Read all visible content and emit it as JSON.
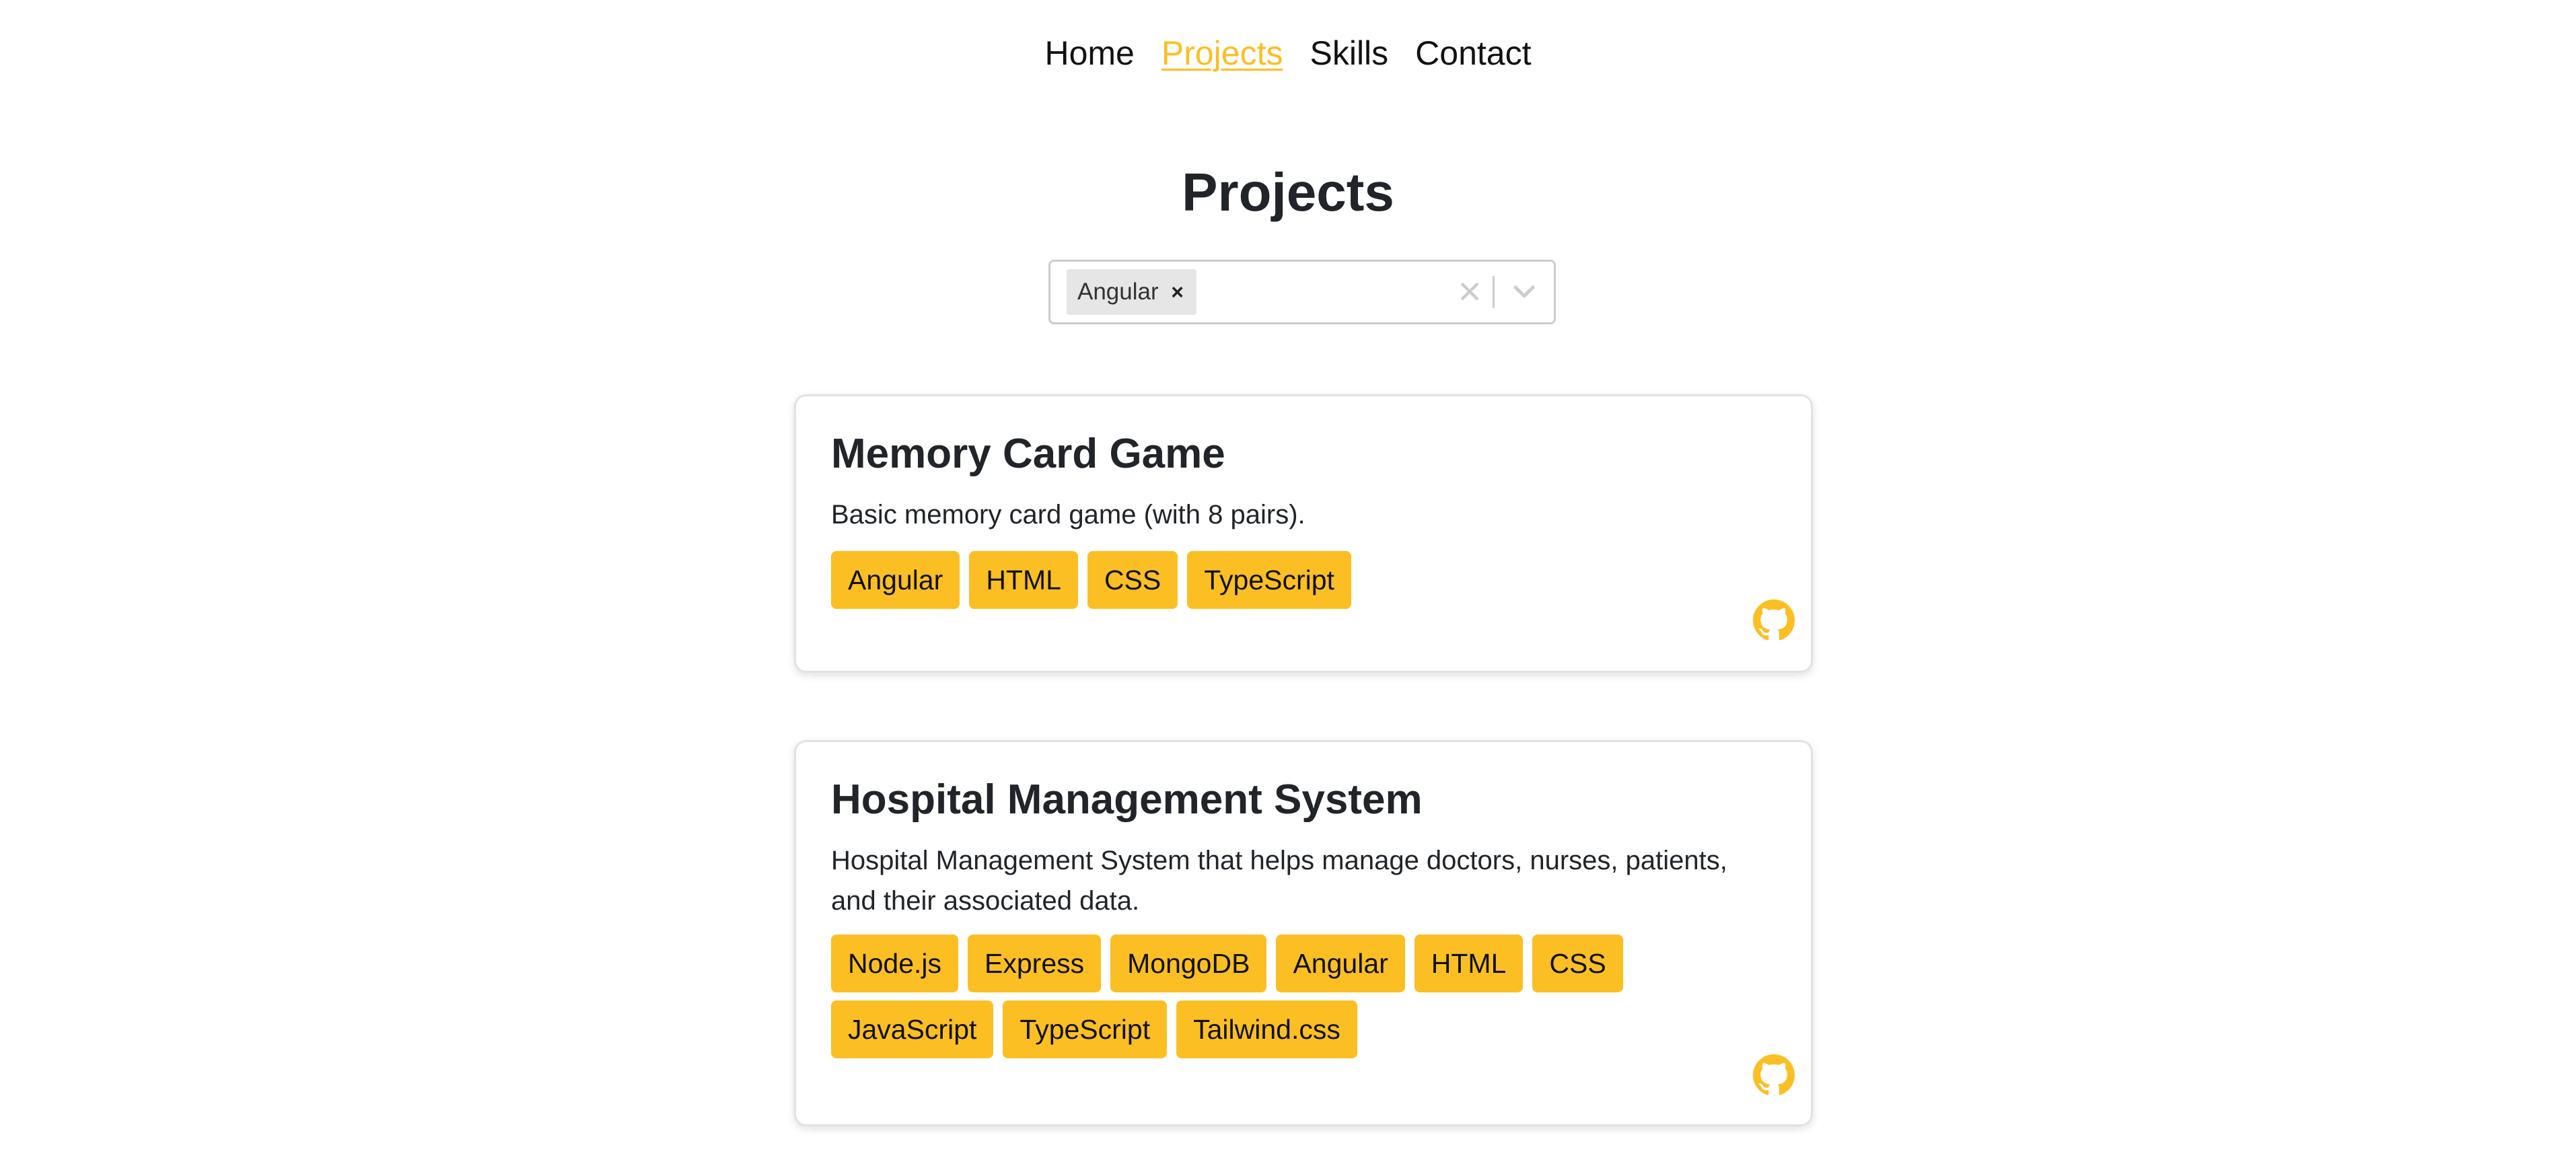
{
  "nav": {
    "items": [
      {
        "label": "Home",
        "active": false
      },
      {
        "label": "Projects",
        "active": true
      },
      {
        "label": "Skills",
        "active": false
      },
      {
        "label": "Contact",
        "active": false
      }
    ]
  },
  "page": {
    "title": "Projects"
  },
  "filter": {
    "selected": [
      {
        "label": "Angular",
        "remove_glyph": "×"
      }
    ],
    "clear_glyph": "✕",
    "dropdown_icon": "chevron-down-icon"
  },
  "projects": [
    {
      "title": "Memory Card Game",
      "description": "Basic memory card game (with 8 pairs).",
      "tags": [
        "Angular",
        "HTML",
        "CSS",
        "TypeScript"
      ],
      "link_icon": "github-icon"
    },
    {
      "title": "Hospital Management System",
      "description": "Hospital Management System that helps manage doctors, nurses, patients, and their associated data.",
      "tags": [
        "Node.js",
        "Express",
        "MongoDB",
        "Angular",
        "HTML",
        "CSS",
        "JavaScript",
        "TypeScript",
        "Tailwind.css"
      ],
      "link_icon": "github-icon"
    }
  ],
  "colors": {
    "accent": "#fbbf24",
    "text": "#212529",
    "border": "#cccccc"
  }
}
